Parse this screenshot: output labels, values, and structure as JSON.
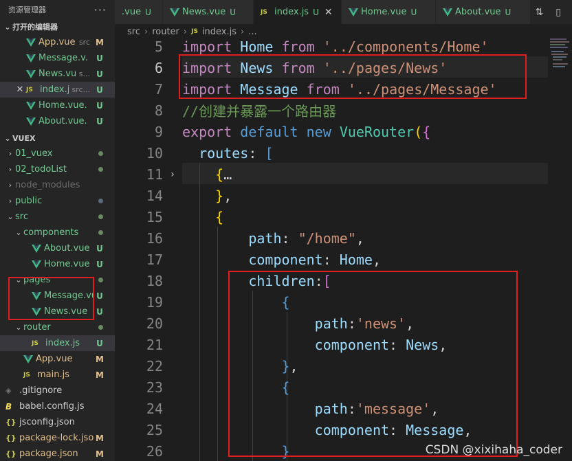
{
  "sidebar": {
    "title": "资源管理器",
    "more_icon": "ellipsis-icon",
    "open_editors_label": "打开的编辑器",
    "open_editors": [
      {
        "label": "App.vue",
        "desc": "src",
        "badge": "M",
        "type": "vue"
      },
      {
        "label": "Message.v...",
        "desc": "",
        "badge": "U",
        "type": "vue"
      },
      {
        "label": "News.vue",
        "desc": "s...",
        "badge": "U",
        "type": "vue"
      },
      {
        "label": "index.js",
        "desc": "src...",
        "badge": "U",
        "type": "js"
      },
      {
        "label": "Home.vue...",
        "desc": "",
        "badge": "U",
        "type": "vue"
      },
      {
        "label": "About.vue...",
        "desc": "",
        "badge": "U",
        "type": "vue"
      }
    ],
    "project_label": "VUEX",
    "tree": [
      {
        "label": "01_vuex",
        "kind": "folder",
        "status": "dot"
      },
      {
        "label": "02_todoList",
        "kind": "folder",
        "status": "dot"
      },
      {
        "label": "node_modules",
        "kind": "folder-dim",
        "status": ""
      },
      {
        "label": "public",
        "kind": "folder",
        "status": "dot"
      },
      {
        "label": "src",
        "kind": "folder-open",
        "status": "dot"
      },
      {
        "label": "components",
        "kind": "folder-open",
        "status": "dot"
      },
      {
        "label": "About.vue",
        "kind": "vue",
        "status": "U"
      },
      {
        "label": "Home.vue",
        "kind": "vue",
        "status": "U"
      },
      {
        "label": "pages",
        "kind": "folder-open",
        "status": "dot"
      },
      {
        "label": "Message.vue",
        "kind": "vue",
        "status": "U"
      },
      {
        "label": "News.vue",
        "kind": "vue",
        "status": "U"
      },
      {
        "label": "router",
        "kind": "folder-open",
        "status": "dot"
      },
      {
        "label": "index.js",
        "kind": "js",
        "status": "U"
      },
      {
        "label": "App.vue",
        "kind": "vue",
        "status": "M"
      },
      {
        "label": "main.js",
        "kind": "js",
        "status": "M"
      },
      {
        "label": ".gitignore",
        "kind": "git",
        "status": ""
      },
      {
        "label": "babel.config.js",
        "kind": "babel",
        "status": ""
      },
      {
        "label": "jsconfig.json",
        "kind": "json",
        "status": ""
      },
      {
        "label": "package-lock.json",
        "kind": "json",
        "status": "M"
      },
      {
        "label": "package.json",
        "kind": "json",
        "status": "M"
      }
    ]
  },
  "tabs": [
    {
      "label": ".vue",
      "badge": "U",
      "type": "vue"
    },
    {
      "label": "News.vue",
      "badge": "U",
      "type": "vue"
    },
    {
      "label": "index.js",
      "badge": "U",
      "type": "js",
      "active": true
    },
    {
      "label": "Home.vue",
      "badge": "U",
      "type": "vue"
    },
    {
      "label": "About.vue",
      "badge": "U",
      "type": "vue"
    }
  ],
  "breadcrumb": [
    "src",
    "router",
    "index.js",
    "..."
  ],
  "code_lines": [
    {
      "n": "5",
      "html": "<span class=\"kw\">import</span> <span class=\"id\">Home</span> <span class=\"kw\">from</span> <span class=\"str\">'../components/Home'</span>"
    },
    {
      "n": "6",
      "html": "<span class=\"kw\">import</span> <span class=\"id\">News</span> <span class=\"kw\">from</span> <span class=\"str\">'../pages/News'</span>"
    },
    {
      "n": "7",
      "html": "<span class=\"kw\">import</span> <span class=\"id\">Message</span> <span class=\"kw\">from</span> <span class=\"str\">'../pages/Message'</span>"
    },
    {
      "n": "8",
      "html": "<span class=\"com\">//创建并暴露一个路由器</span>"
    },
    {
      "n": "9",
      "html": "<span class=\"kw\">export</span> <span class=\"kw2\">default</span> <span class=\"kw2\">new</span> <span class=\"cls\">VueRouter</span><span class=\"br\">(</span><span class=\"br2\">{</span>"
    },
    {
      "n": "10",
      "html": "  <span class=\"id\">routes</span>: <span class=\"kw2\">[</span>"
    },
    {
      "n": "11",
      "html": "    <span class=\"br\">{</span>…"
    },
    {
      "n": "14",
      "html": "    <span class=\"br\">}</span>,"
    },
    {
      "n": "15",
      "html": "    <span class=\"br\">{</span>"
    },
    {
      "n": "16",
      "html": "        <span class=\"id\">path</span>: <span class=\"str\">\"/home\"</span>,"
    },
    {
      "n": "17",
      "html": "        <span class=\"id\">component</span>: <span class=\"id\">Home</span>,"
    },
    {
      "n": "18",
      "html": "        <span class=\"id\">children</span>:<span class=\"br2\">[</span>"
    },
    {
      "n": "19",
      "html": "            <span class=\"kw2\">{</span>"
    },
    {
      "n": "20",
      "html": "                <span class=\"id\">path</span>:<span class=\"str\">'news'</span>,"
    },
    {
      "n": "21",
      "html": "                <span class=\"id\">component</span>: <span class=\"id\">News</span>,"
    },
    {
      "n": "22",
      "html": "            <span class=\"kw2\">}</span>,"
    },
    {
      "n": "23",
      "html": "            <span class=\"kw2\">{</span>"
    },
    {
      "n": "24",
      "html": "                <span class=\"id\">path</span>:<span class=\"str\">'message'</span>,"
    },
    {
      "n": "25",
      "html": "                <span class=\"id\">component</span>: <span class=\"id\">Message</span>,"
    },
    {
      "n": "26",
      "html": "            <span class=\"kw2\">}</span>"
    }
  ],
  "current_line": "6",
  "watermark": "CSDN @xixihaha_coder",
  "colors": {
    "modified": "#e2c08d",
    "untracked": "#73c991",
    "highlight_box": "#e02020"
  }
}
